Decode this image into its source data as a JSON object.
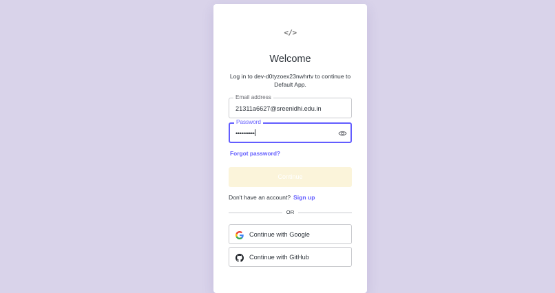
{
  "logo": {
    "text": "</>"
  },
  "header": {
    "title": "Welcome",
    "subtitle": "Log in to dev-d0tyzoex23nwhrtv to continue to Default App."
  },
  "form": {
    "email": {
      "label": "Email address",
      "value": "21311a6627@sreenidhi.edu.in"
    },
    "password": {
      "label": "Password",
      "masked_value": "••••••••••"
    },
    "forgot_label": "Forgot password?",
    "continue_label": "Continue"
  },
  "signup": {
    "prompt": "Don't have an account?",
    "link_label": "Sign up"
  },
  "divider": {
    "label": "OR"
  },
  "social": [
    {
      "label": "Continue with Google",
      "icon": "google-icon"
    },
    {
      "label": "Continue with GitHub",
      "icon": "github-icon"
    }
  ],
  "colors": {
    "accent": "#635dff",
    "background": "#d9d3ea",
    "continue_disabled": "#fbf4da"
  }
}
